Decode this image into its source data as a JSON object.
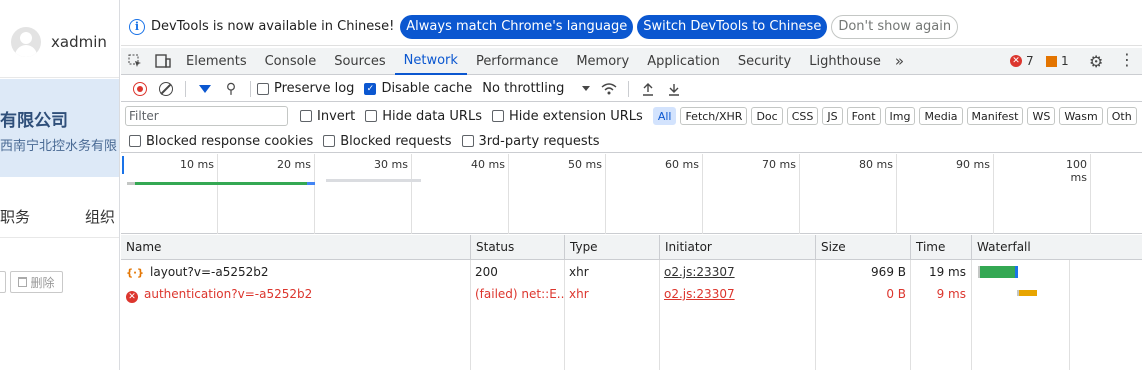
{
  "app": {
    "username": "xadmin",
    "company_title": "有限公司",
    "company_sub": "西南宁北控水务有限",
    "nav": [
      "职务",
      "组织"
    ],
    "delete_label": "删除"
  },
  "infobar": {
    "message": "DevTools is now available in Chinese!",
    "btn_match": "Always match Chrome's language",
    "btn_switch": "Switch DevTools to Chinese",
    "btn_dismiss": "Don't show again"
  },
  "tabs": [
    "Elements",
    "Console",
    "Sources",
    "Network",
    "Performance",
    "Memory",
    "Application",
    "Security",
    "Lighthouse"
  ],
  "active_tab": "Network",
  "overflow_label": "»",
  "errors_count": "7",
  "warnings_count": "1",
  "toolbar": {
    "preserve_log": "Preserve log",
    "disable_cache": "Disable cache",
    "throttle": "No throttling"
  },
  "filter": {
    "placeholder": "Filter",
    "invert": "Invert",
    "hide_data_urls": "Hide data URLs",
    "hide_extension_urls": "Hide extension URLs",
    "chips": [
      "All",
      "Fetch/XHR",
      "Doc",
      "CSS",
      "JS",
      "Font",
      "Img",
      "Media",
      "Manifest",
      "WS",
      "Wasm",
      "Oth"
    ]
  },
  "options": {
    "blocked_cookies": "Blocked response cookies",
    "blocked_requests": "Blocked requests",
    "third_party": "3rd-party requests"
  },
  "timeline_ticks": [
    "10 ms",
    "20 ms",
    "30 ms",
    "40 ms",
    "50 ms",
    "60 ms",
    "70 ms",
    "80 ms",
    "90 ms",
    "100 ms"
  ],
  "columns": [
    "Name",
    "Status",
    "Type",
    "Initiator",
    "Size",
    "Time",
    "Waterfall"
  ],
  "requests": [
    {
      "name": "layout?v=-a5252b2",
      "status": "200",
      "type": "xhr",
      "initiator": "o2.js:23307",
      "size": "969 B",
      "time": "19 ms",
      "failed": false
    },
    {
      "name": "authentication?v=-a5252b2",
      "status": "(failed) net::E...",
      "type": "xhr",
      "initiator": "o2.js:23307",
      "size": "0 B",
      "time": "9 ms",
      "failed": true
    }
  ],
  "colors": {
    "accent": "#0b57d0",
    "error": "#dc362e",
    "success": "#34a853",
    "waiting": "#e8a500"
  }
}
